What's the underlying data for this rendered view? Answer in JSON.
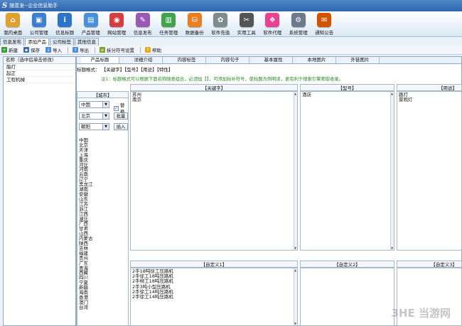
{
  "app": {
    "logo": "S",
    "title": "随意发--企业信息助手"
  },
  "toolbar": [
    {
      "label": "我的桌面",
      "icon": "home-icon",
      "color": "#e0a030",
      "glyph": "⌂"
    },
    {
      "label": "公司管理",
      "icon": "company-icon",
      "color": "#3a7fd0",
      "glyph": "▣"
    },
    {
      "label": "信息标题",
      "icon": "info-icon",
      "color": "#2b74c9",
      "glyph": "i"
    },
    {
      "label": "产品管理",
      "icon": "product-icon",
      "color": "#4a8fd8",
      "glyph": "▤"
    },
    {
      "label": "网站管理",
      "icon": "website-icon",
      "color": "#d04040",
      "glyph": "◉"
    },
    {
      "label": "信息发布",
      "icon": "publish-icon",
      "color": "#9b59b6",
      "glyph": "✎"
    },
    {
      "label": "任务管理",
      "icon": "task-icon",
      "color": "#3fa34d",
      "glyph": "▥"
    },
    {
      "label": "数据备份",
      "icon": "backup-icon",
      "color": "#e67e22",
      "glyph": "⛁"
    },
    {
      "label": "软件充值",
      "icon": "recharge-icon",
      "color": "#7f8c8d",
      "glyph": "✿"
    },
    {
      "label": "实用工具",
      "icon": "tools-icon",
      "color": "#555555",
      "glyph": "✂"
    },
    {
      "label": "软件代理",
      "icon": "agent-icon",
      "color": "#e84393",
      "glyph": "❖"
    },
    {
      "label": "系统管理",
      "icon": "settings-icon",
      "color": "#6b7b8c",
      "glyph": "⚙"
    },
    {
      "label": "通知公告",
      "icon": "notice-icon",
      "color": "#d35400",
      "glyph": "✉"
    }
  ],
  "top_tabs": [
    "信息发布",
    "添加产品",
    "公司标签",
    "其他信息"
  ],
  "actions": [
    {
      "label": "新建",
      "icon": "new-icon",
      "color": "#3a9a3a",
      "glyph": "+"
    },
    {
      "label": "保存",
      "icon": "save-icon",
      "color": "#3a6fb0",
      "glyph": "▪"
    },
    {
      "label": "导入",
      "icon": "import-icon",
      "color": "#4a8fd8",
      "glyph": "↓"
    },
    {
      "label": "导出",
      "icon": "export-icon",
      "color": "#4a8fd8",
      "glyph": "↑"
    },
    {
      "label": "拆分符号设置",
      "icon": "split-icon",
      "color": "#7aa32a",
      "glyph": "≡"
    },
    {
      "label": "帮助",
      "icon": "help-icon",
      "color": "#e6a817",
      "glyph": "?"
    }
  ],
  "left_panel": {
    "header": "名称（选中后单击修改）",
    "items": [
      "脂灯",
      "起正",
      "工程机械"
    ]
  },
  "sub_tabs": [
    "产品标题",
    "详细介绍",
    "内容标签",
    "内容句子",
    "基本属性",
    "本地图片",
    "外链图片"
  ],
  "title_format": {
    "label": "标题格式：",
    "value": "【关键字】【型号】【用途】【特性】"
  },
  "note": "注1：标题格式可以根据下面名称随意组合，必须加【】，可添加标补符号，使标题为例明读，更有利于搜索引擎爬取收录。",
  "panels": {
    "city": "【城市】",
    "keyword": "【关键字】",
    "model": "【型号】",
    "usage": "【用途】",
    "custom1": "【自定义1】",
    "custom2": "【自定义2】",
    "custom3": "【自定义3】"
  },
  "city_controls": {
    "country": "中国",
    "province": "北京",
    "city": "朝阳",
    "replace_label": "替换",
    "batch_button": "批量",
    "insert_button": "插入"
  },
  "cities": [
    "中国",
    "北京",
    "天津",
    "上海",
    "重庆",
    "河北",
    "河南",
    "云南",
    "辽宁",
    "黑龙江",
    "湖南",
    "安徽",
    "山东",
    "江苏",
    "浙江",
    "江西",
    "湖北",
    "广西",
    "甘肃",
    "山西",
    "内蒙古",
    "陕西",
    "吉林",
    "福建",
    "贵州",
    "广东",
    "青海",
    "西藏",
    "四川",
    "宁夏",
    "新疆",
    "海南",
    "香港",
    "澳门",
    "台湾"
  ],
  "keywords": [
    "苏州",
    "南京"
  ],
  "models": [
    "酒店"
  ],
  "usages": [
    "路灯",
    "景观灯"
  ],
  "custom1_items": [
    "2手18吨徐工压路机",
    "2手徐工18吨压路机",
    "2手柳工18吨压路机",
    "2手3吨小型压路机",
    "2手徐工14吨压路机",
    "2手徐工14吨压路机"
  ],
  "watermark": "3HE 当游网"
}
